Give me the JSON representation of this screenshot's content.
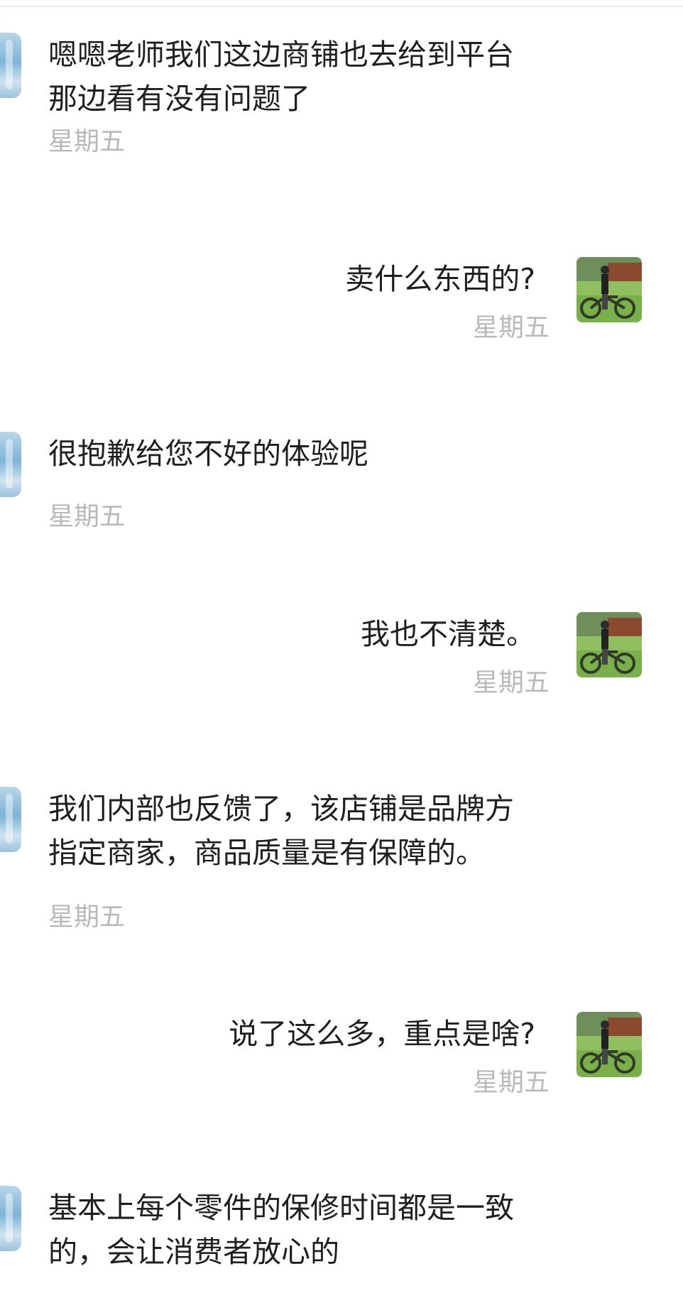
{
  "messages": [
    {
      "side": "left",
      "text_lines": [
        "嗯嗯老师我们这边商铺也去给到平台",
        "那边看有没有问题了"
      ],
      "time": "星期五"
    },
    {
      "side": "right",
      "text": "卖什么东西的?",
      "time": "星期五"
    },
    {
      "side": "left",
      "text_lines": [
        "很抱歉给您不好的体验呢"
      ],
      "time": "星期五"
    },
    {
      "side": "right",
      "text": "我也不清楚。",
      "time": "星期五"
    },
    {
      "side": "left",
      "text_lines": [
        "我们内部也反馈了，该店铺是品牌方",
        "指定商家，商品质量是有保障的。"
      ],
      "time": "星期五"
    },
    {
      "side": "right",
      "text": "说了这么多，重点是啥?",
      "time": "星期五"
    },
    {
      "side": "left",
      "text_lines": [
        "基本上每个零件的保修时间都是一致",
        "的，会让消费者放心的"
      ]
    }
  ]
}
